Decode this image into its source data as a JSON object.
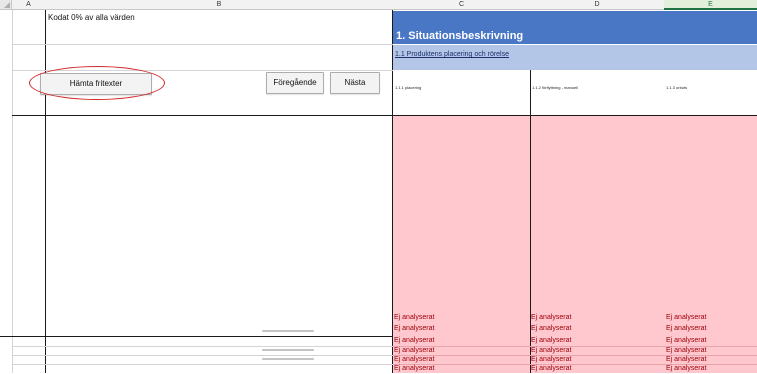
{
  "columns": [
    "A",
    "B",
    "C",
    "D",
    "E"
  ],
  "sheet": {
    "coverage_text": "Kodat 0% av alla värden"
  },
  "buttons": {
    "fetch_label": "Hämta fritexter",
    "prev_label": "Föregående",
    "next_label": "Nästa"
  },
  "section": {
    "title": "1. Situationsbeskrivning",
    "subtitle": "1.1 Produktens placering och rörelse",
    "sub_headers": [
      "1.1.1 placering",
      "1.1.2 förflyttning - manuell",
      "1.1.3 orbots"
    ]
  },
  "status_label": "Ej analyserat",
  "colors": {
    "header_blue": "#4a76c6",
    "sub_blue": "#b4c6e7",
    "not_analyzed_fill": "#ffc7ce",
    "not_analyzed_text": "#9c0006",
    "highlight_oval": "#d12a2a"
  }
}
